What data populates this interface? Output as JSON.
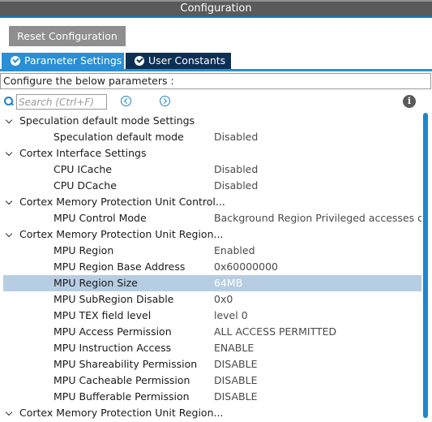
{
  "window": {
    "title": "Configuration"
  },
  "toolbar": {
    "reset_label": "Reset Configuration"
  },
  "tabs": [
    {
      "label": "Parameter Settings",
      "active": true,
      "icon": "check-circle-icon"
    },
    {
      "label": "User Constants",
      "active": false,
      "icon": "check-circle-icon"
    }
  ],
  "configure_text": "Configure the below parameters :",
  "search": {
    "placeholder": "Search (Ctrl+F)",
    "value": ""
  },
  "colors": {
    "accent": "#2a8fd4",
    "tab_inactive": "#0e2f54",
    "selection": "#b7cde3",
    "titlebar": "#5a5a5a"
  },
  "tree": {
    "groups": [
      {
        "label": "Speculation default mode Settings",
        "items": [
          {
            "name": "Speculation default mode",
            "value": "Disabled"
          }
        ]
      },
      {
        "label": "Cortex Interface Settings",
        "items": [
          {
            "name": "CPU ICache",
            "value": "Disabled"
          },
          {
            "name": "CPU DCache",
            "value": "Disabled"
          }
        ]
      },
      {
        "label": "Cortex Memory Protection Unit Control...",
        "items": [
          {
            "name": "MPU Control Mode",
            "value": "Background Region Privileged accesses o..."
          }
        ]
      },
      {
        "label": "Cortex Memory Protection Unit Region...",
        "items": [
          {
            "name": "MPU Region",
            "value": "Enabled"
          },
          {
            "name": "MPU Region Base Address",
            "value": "0x60000000"
          },
          {
            "name": "MPU Region Size",
            "value": "64MB",
            "selected": true
          },
          {
            "name": "MPU SubRegion Disable",
            "value": "0x0"
          },
          {
            "name": "MPU TEX field level",
            "value": "level 0"
          },
          {
            "name": "MPU Access Permission",
            "value": "ALL ACCESS PERMITTED"
          },
          {
            "name": "MPU Instruction Access",
            "value": "ENABLE"
          },
          {
            "name": "MPU Shareability Permission",
            "value": "DISABLE"
          },
          {
            "name": "MPU Cacheable Permission",
            "value": "DISABLE"
          },
          {
            "name": "MPU Bufferable  Permission",
            "value": "DISABLE"
          }
        ]
      },
      {
        "label": "Cortex Memory Protection Unit Region...",
        "items": []
      }
    ]
  }
}
